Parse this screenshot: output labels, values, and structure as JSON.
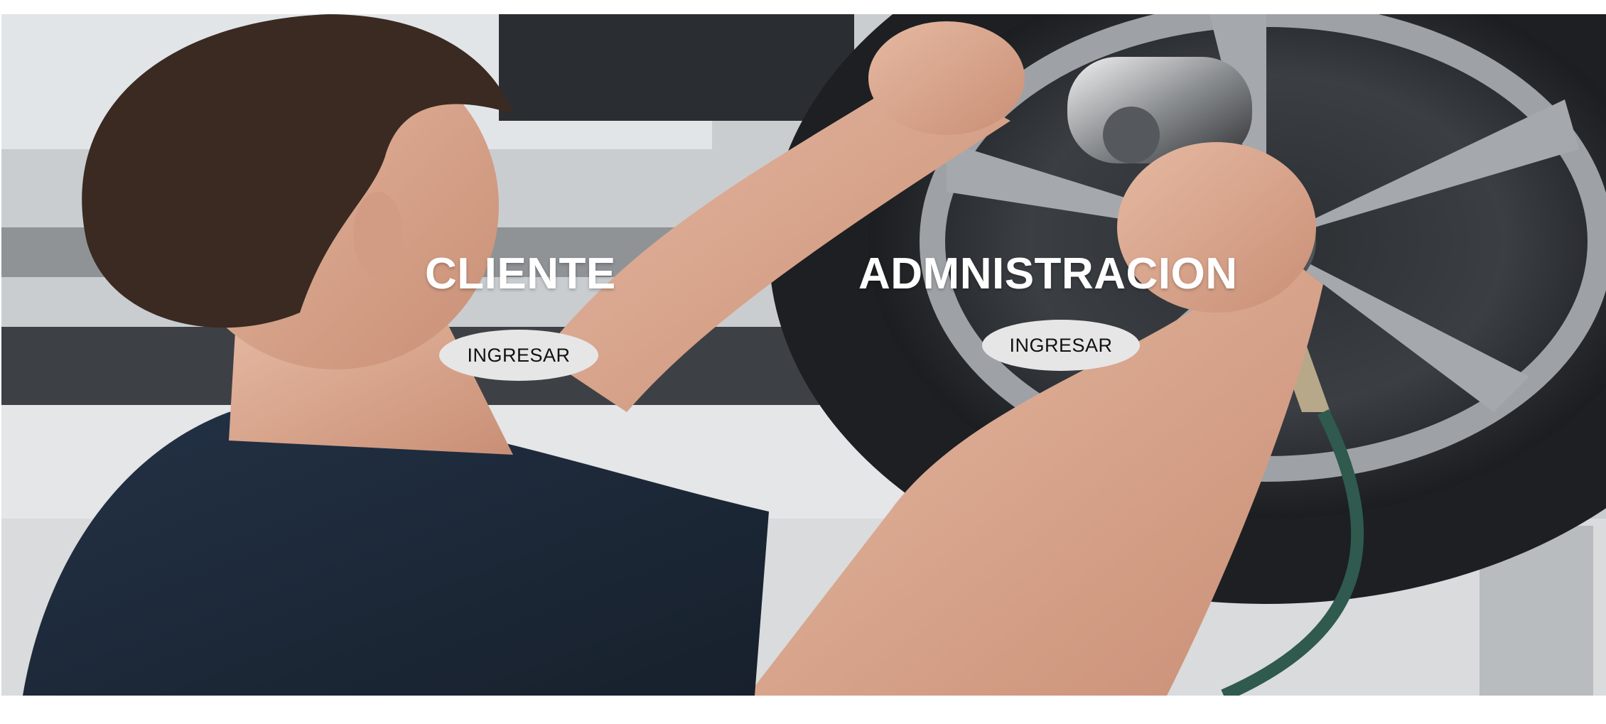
{
  "hero": {
    "image": "mechanic-changing-tire-photo"
  },
  "cards": [
    {
      "title": "CLIENTE",
      "button_label": "INGRESAR"
    },
    {
      "title": "ADMNISTRACION",
      "button_label": "INGRESAR"
    }
  ],
  "colors": {
    "heading_text": "#ffffff",
    "button_bg": "#e6e6e6",
    "button_text": "#111111",
    "page_bg": "#ffffff"
  }
}
